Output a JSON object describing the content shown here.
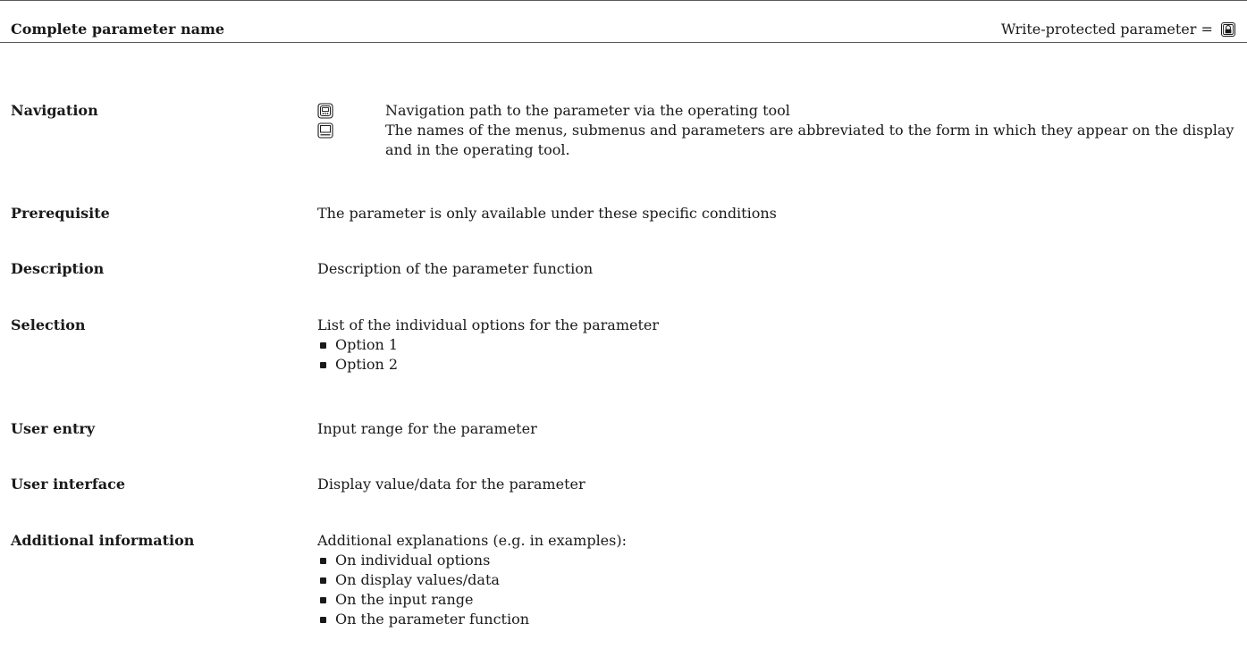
{
  "header": {
    "title": "Complete parameter name",
    "write_protected_label": "Write-protected parameter =",
    "lock_icon": "lock-icon"
  },
  "rows": {
    "navigation": {
      "label": "Navigation",
      "lines": [
        {
          "icon": "operating-tool-icon",
          "text": "Navigation path to the parameter via the operating tool"
        },
        {
          "icon": "display-icon",
          "text": "The names of the menus, submenus and parameters are abbreviated to the form in which they appear on the display and in the operating tool."
        }
      ]
    },
    "prerequisite": {
      "label": "Prerequisite",
      "text": "The parameter is only available under these specific conditions"
    },
    "description": {
      "label": "Description",
      "text": "Description of the parameter function"
    },
    "selection": {
      "label": "Selection",
      "text": "List of the individual options for the parameter",
      "items": [
        "Option 1",
        "Option 2"
      ]
    },
    "user_entry": {
      "label": "User entry",
      "text": "Input range for the parameter"
    },
    "user_interface": {
      "label": "User interface",
      "text": "Display value/data for the parameter"
    },
    "additional_information": {
      "label": "Additional information",
      "text": "Additional explanations (e.g. in examples):",
      "items": [
        "On individual options",
        "On display values/data",
        "On the input range",
        "On the parameter function"
      ]
    }
  }
}
